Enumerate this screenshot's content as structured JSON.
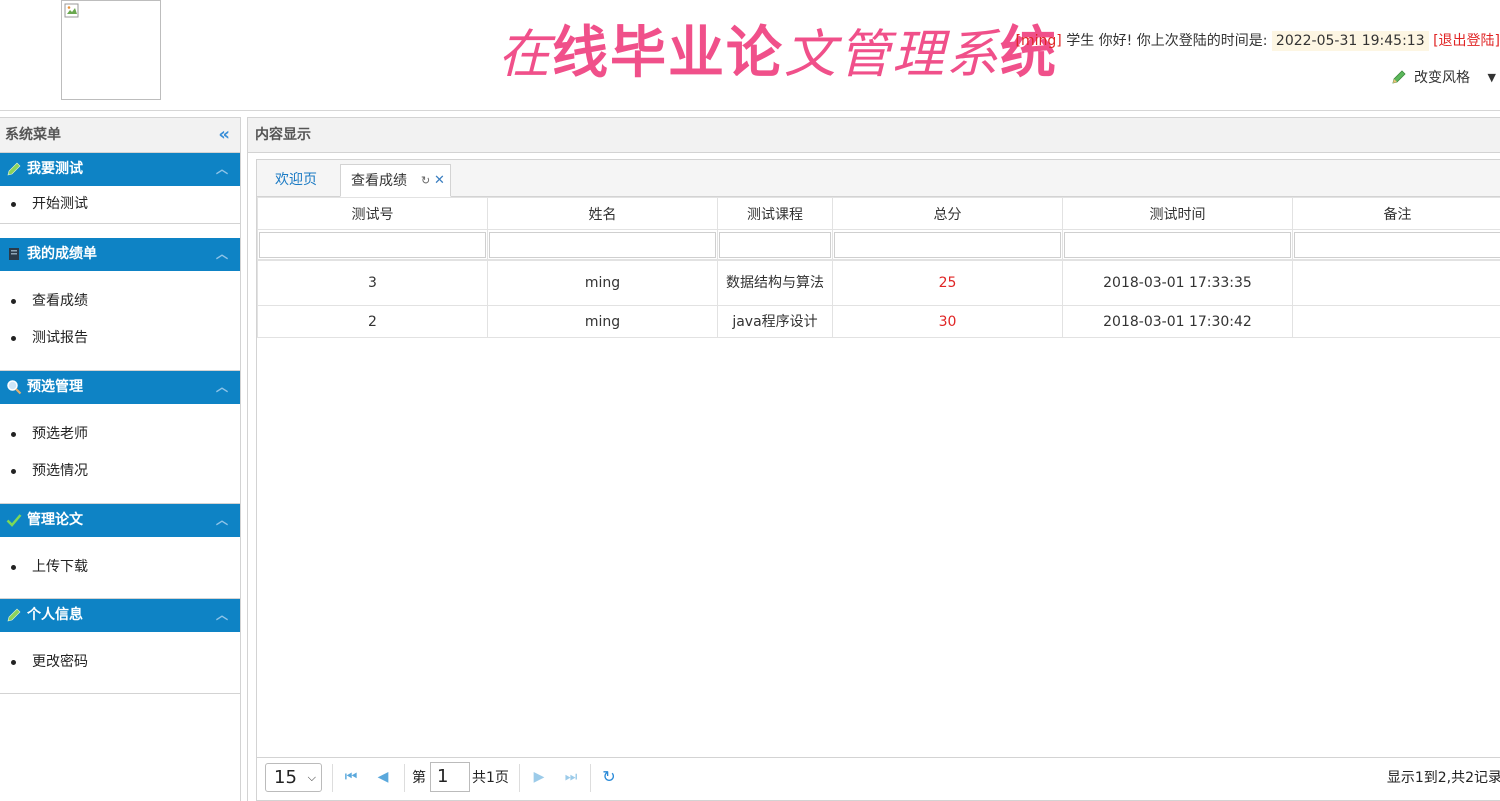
{
  "header": {
    "title_part1": "在",
    "title_part2": "线毕业论",
    "title_part3": "文管理系",
    "title_part4": "统",
    "user_name": "[ming]",
    "user_role_greeting": " 学生  你好! 你上次登陆的时间是: ",
    "last_login": "2022-05-31 19:45:13",
    "logout": "[退出登陆]",
    "style_switch": "改变风格"
  },
  "sidebar": {
    "title": "系统菜单",
    "collapse_icon": "«",
    "groups": [
      {
        "label": "我要测试",
        "icon": "pencil-icon",
        "items": [
          "开始测试"
        ]
      },
      {
        "label": "我的成绩单",
        "icon": "document-icon",
        "items": [
          "查看成绩",
          "测试报告"
        ]
      },
      {
        "label": "预选管理",
        "icon": "search-icon",
        "items": [
          "预选老师",
          "预选情况"
        ]
      },
      {
        "label": "管理论文",
        "icon": "check-icon",
        "items": [
          "上传下载"
        ]
      },
      {
        "label": "个人信息",
        "icon": "pencil-icon",
        "items": [
          "更改密码"
        ]
      }
    ]
  },
  "content": {
    "title": "内容显示",
    "tabs": [
      {
        "label": "欢迎页"
      },
      {
        "label": "查看成绩"
      }
    ],
    "table": {
      "columns": [
        "测试号",
        "姓名",
        "测试课程",
        "总分",
        "测试时间",
        "备注"
      ],
      "rows": [
        [
          "3",
          "ming",
          "数据结构与算法",
          "25",
          "2018-03-01 17:33:35",
          ""
        ],
        [
          "2",
          "ming",
          "java程序设计",
          "30",
          "2018-03-01 17:30:42",
          ""
        ]
      ]
    },
    "pager": {
      "page_size": "15",
      "page_prefix": "第",
      "page_number": "1",
      "page_total": "共1页",
      "info": "显示1到2,共2记录"
    }
  },
  "colors": {
    "menu_blue": "#0e83c5",
    "title_pink": "#f0508a",
    "score_red": "#e02525"
  }
}
